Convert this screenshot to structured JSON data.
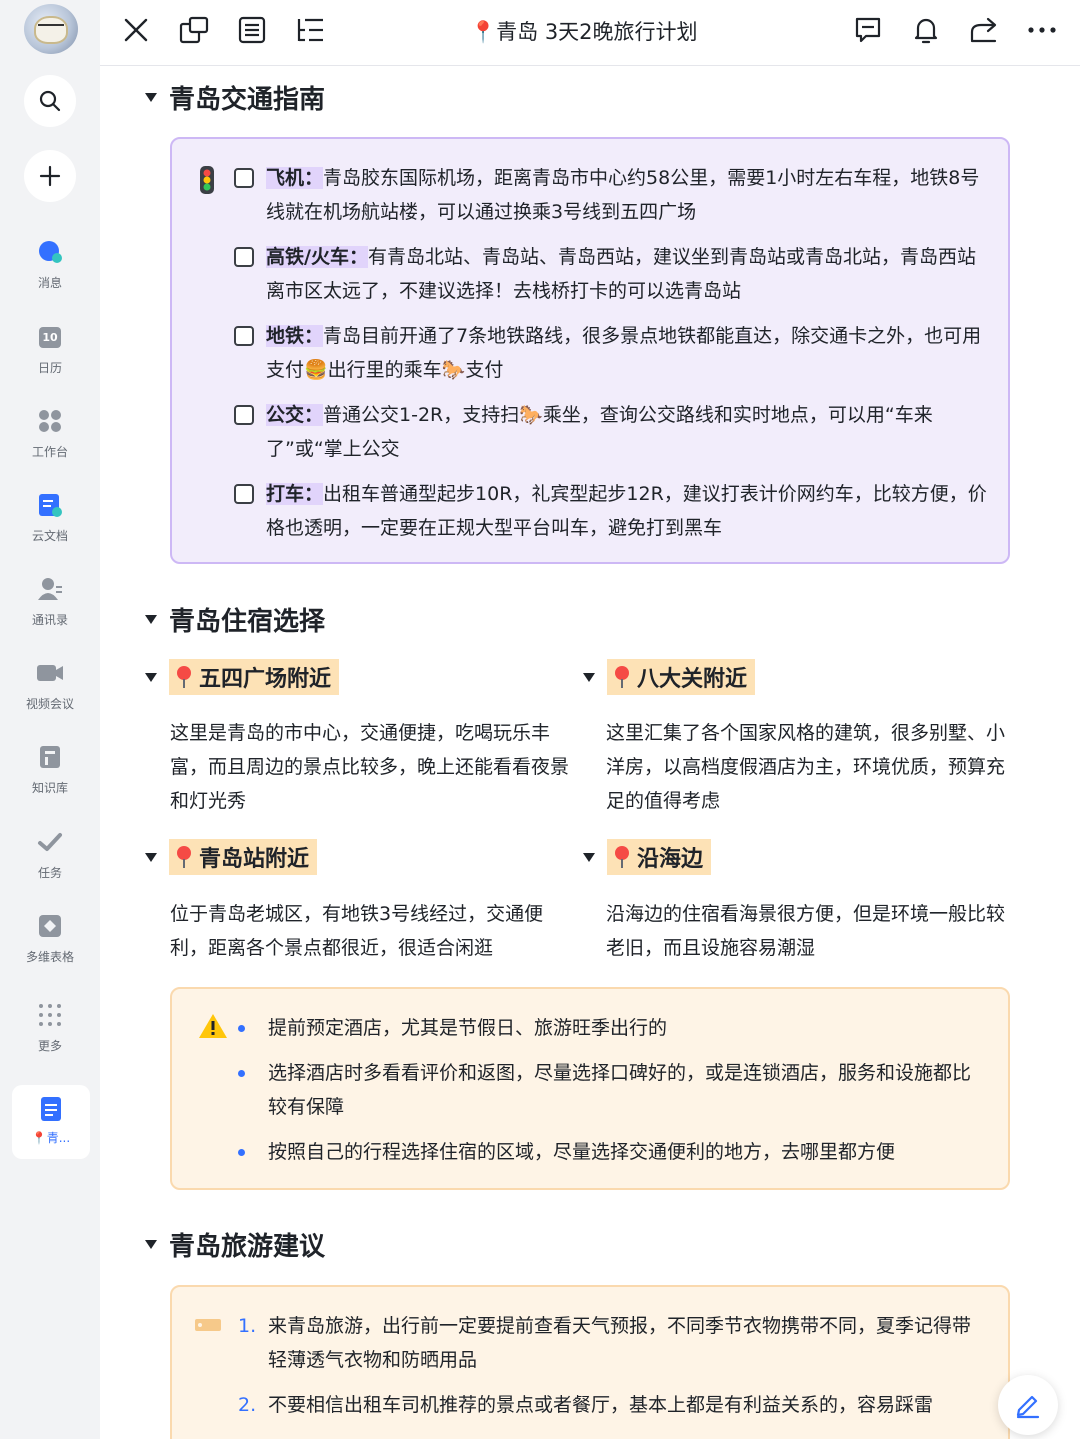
{
  "sidebar": {
    "nav": [
      {
        "label": "消息",
        "icon": "chat-bubble-icon"
      },
      {
        "label": "日历",
        "icon": "calendar-icon",
        "calendar_day": "10"
      },
      {
        "label": "工作台",
        "icon": "workspace-grid-icon"
      },
      {
        "label": "云文档",
        "icon": "cloud-doc-icon"
      },
      {
        "label": "通讯录",
        "icon": "contacts-icon"
      },
      {
        "label": "视频会议",
        "icon": "video-camera-icon"
      },
      {
        "label": "知识库",
        "icon": "knowledge-base-icon"
      },
      {
        "label": "任务",
        "icon": "task-check-icon"
      },
      {
        "label": "多维表格",
        "icon": "bitable-icon"
      },
      {
        "label": "更多",
        "icon": "more-dots-grid-icon"
      }
    ],
    "active_doc_label": "📍青..."
  },
  "topbar": {
    "title": "📍青岛 3天2晚旅行计划"
  },
  "sections": {
    "transport": {
      "heading": "青岛交通指南",
      "items": [
        {
          "key": "飞机：",
          "text": "青岛胶东国际机场，距离青岛市中心约58公里，需要1小时左右车程，地铁8号线就在机场航站楼，可以通过换乘3号线到五四广场"
        },
        {
          "key": "高铁/火车：",
          "text": "有青岛北站、青岛站、青岛西站，建议坐到青岛站或青岛北站，青岛西站离市区太远了，不建议选择！去栈桥打卡的可以选青岛站"
        },
        {
          "key": "地铁：",
          "text": "青岛目前开通了7条地铁路线，很多景点地铁都能直达，除交通卡之外，也可用支付🍔出行里的乘车🐎支付"
        },
        {
          "key": "公交：",
          "text": "普通公交1-2R，支持扫🐎乘坐，查询公交路线和实时地点，可以用“车来了”或“掌上公交"
        },
        {
          "key": "打车：",
          "text": "出租车普通型起步10R，礼宾型起步12R，建议打表计价网约车，比较方便，价格也透明，一定要在正规大型平台叫车，避免打到黑车"
        }
      ]
    },
    "lodging": {
      "heading": "青岛住宿选择",
      "areas": [
        {
          "title": "五四广场附近",
          "text": "这里是青岛的市中心，交通便捷，吃喝玩乐丰富，而且周边的景点比较多，晚上还能看看夜景和灯光秀"
        },
        {
          "title": "八大关附近",
          "text": "这里汇集了各个国家风格的建筑，很多别墅、小洋房，以高档度假酒店为主，环境优质，预算充足的值得考虑"
        },
        {
          "title": "青岛站附近",
          "text": "位于青岛老城区，有地铁3号线经过，交通便利，距离各个景点都很近，很适合闲逛"
        },
        {
          "title": "沿海边",
          "text": "沿海边的住宿看海景很方便，但是环境一般比较老旧，而且设施容易潮湿"
        }
      ],
      "tips": [
        "提前预定酒店，尤其是节假日、旅游旺季出行的",
        "选择酒店时多看看评价和返图，尽量选择口碑好的，或是连锁酒店，服务和设施都比较有保障",
        "按照自己的行程选择住宿的区域，尽量选择交通便利的地方，去哪里都方便"
      ]
    },
    "advice": {
      "heading": "青岛旅游建议",
      "items": [
        {
          "n": "1.",
          "text": "来青岛旅游，出行前一定要提前查看天气预报，不同季节衣物携带不同，夏季记得带轻薄透气衣物和防晒用品"
        },
        {
          "n": "2.",
          "text": "不要相信出租车司机推荐的景点或者餐厅，基本上都是有利益关系的，容易踩雷"
        }
      ]
    }
  },
  "colors": {
    "accent": "#3370ff",
    "purple_callout_bg": "#f2edfb",
    "purple_callout_border": "#cdb8f5",
    "orange_callout_bg": "#fef4e6",
    "highlight_orange": "#fde2b6",
    "highlight_purple": "#e1d4fb"
  }
}
